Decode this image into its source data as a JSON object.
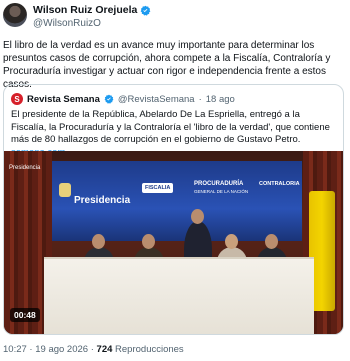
{
  "author": {
    "display_name": "Wilson Ruiz Orejuela",
    "handle": "@WilsonRuizO"
  },
  "tweet": {
    "text": "El libro de la verdad es un avance muy importante para determinar los presuntos casos de corrupción, ahora compete a la Fiscalía, Contraloría y Procuraduría investigar y actuar con rigor e independencia frente a estos casos."
  },
  "quote": {
    "avatar_letter": "S",
    "display_name": "Revista Semana",
    "handle": "@RevistaSemana",
    "separator": "·",
    "time": "18 ago",
    "text": "El presidente de la República, Abelardo De La Espriella, entregó a la Fiscalía, la Procuraduría y la Contraloría el 'libro de la verdad', que contiene más de 80 hallazgos de corrupción en el gobierno de Gustavo Petro.",
    "link": "semana.com",
    "video": {
      "duration": "00:48",
      "corner_label": "Presidencia",
      "screen_labels": {
        "presidencia": "Presidencia",
        "fiscalia": "FISCALIA",
        "procuraduria_line1": "PROCURADURÍA",
        "procuraduria_line2": "GENERAL DE LA NACIÓN",
        "contraloria": "CONTRALORIA"
      }
    }
  },
  "footer": {
    "time": "10:27",
    "separator": "·",
    "date": "19 ago 2026",
    "views_count": "724",
    "views_label": "Reproducciones"
  },
  "colors": {
    "verified": "#1d9bf0",
    "link": "#1d9bf0",
    "semana_red": "#d6202a"
  }
}
